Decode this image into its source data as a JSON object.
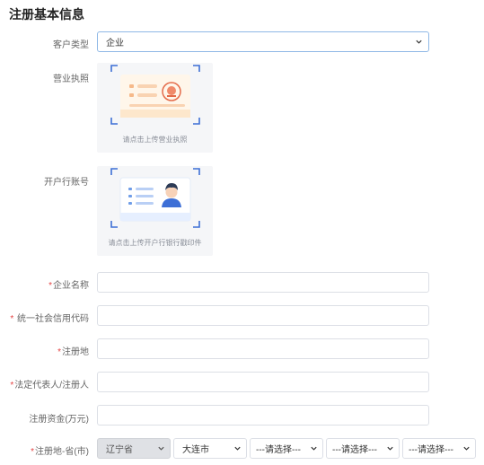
{
  "page": {
    "title": "注册基本信息"
  },
  "customer_type": {
    "label": "客户类型",
    "value": "企业"
  },
  "business_license": {
    "label": "营业执照",
    "hint": "请点击上传营业执照"
  },
  "bank_account": {
    "label": "开户行账号",
    "hint": "请点击上传开户行银行戳印件"
  },
  "company_name": {
    "required_mark": "*",
    "label": "企业名称"
  },
  "credit_code": {
    "required_mark": "*",
    "label": " 统一社会信用代码"
  },
  "reg_address": {
    "required_mark": "*",
    "label": "注册地"
  },
  "legal_rep": {
    "required_mark": "*",
    "label": "法定代表人/注册人"
  },
  "reg_capital": {
    "label": "注册资金(万元)"
  },
  "reg_region": {
    "required_mark": "*",
    "label": "注册地-省(市)",
    "province": "辽宁省",
    "city": "大连市",
    "district": "---请选择---",
    "street": "---请选择---",
    "community": "---请选择---"
  },
  "colors": {
    "accent": "#4a8fdc",
    "required": "#e54545",
    "upload_bg": "#f5f6f8"
  }
}
